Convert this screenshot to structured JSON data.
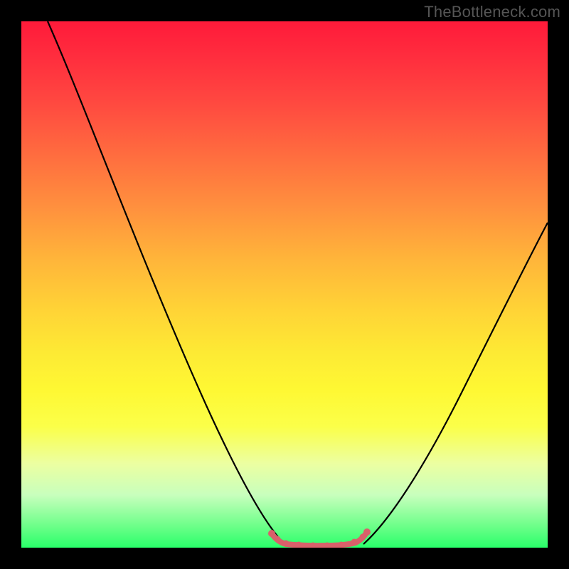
{
  "watermark": "TheBottleneck.com",
  "chart_data": {
    "type": "line",
    "title": "",
    "xlabel": "",
    "ylabel": "",
    "xlim": [
      0,
      100
    ],
    "ylim": [
      0,
      100
    ],
    "grid": false,
    "legend": false,
    "background_gradient": {
      "direction": "vertical",
      "stops": [
        {
          "pct": 0,
          "color": "#ff1a3a"
        },
        {
          "pct": 25,
          "color": "#ff6b3f"
        },
        {
          "pct": 55,
          "color": "#ffd436"
        },
        {
          "pct": 77,
          "color": "#fbff49"
        },
        {
          "pct": 100,
          "color": "#29ff6a"
        }
      ]
    },
    "series": [
      {
        "name": "left-curve",
        "color": "#000000",
        "x": [
          5,
          10,
          15,
          20,
          25,
          30,
          35,
          40,
          45,
          48,
          50
        ],
        "y": [
          100,
          88,
          75,
          63,
          50,
          38,
          26,
          15,
          6,
          2,
          0
        ]
      },
      {
        "name": "right-curve",
        "color": "#000000",
        "x": [
          65,
          68,
          72,
          76,
          80,
          84,
          88,
          92,
          96,
          100
        ],
        "y": [
          0,
          2,
          6,
          12,
          20,
          29,
          38,
          47,
          55,
          62
        ]
      },
      {
        "name": "valley-highlight",
        "color": "#d9606a",
        "type": "scatter",
        "x": [
          48,
          50,
          52,
          54,
          56,
          58,
          60,
          62,
          64,
          65
        ],
        "y": [
          2,
          0.5,
          0,
          0,
          0,
          0,
          0,
          0.5,
          1.5,
          3
        ]
      }
    ]
  }
}
